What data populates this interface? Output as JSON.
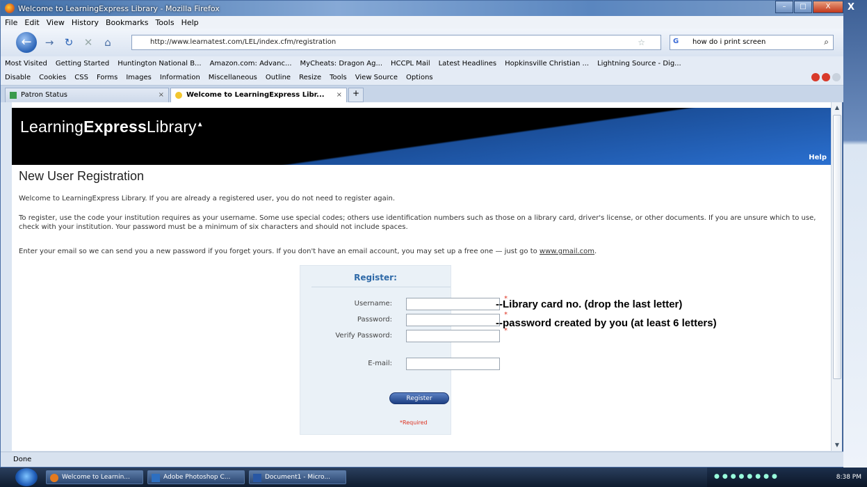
{
  "window": {
    "title": "Welcome to LearningExpress Library - Mozilla Firefox",
    "controls": {
      "minimize": "–",
      "maximize": "□",
      "close": "X"
    }
  },
  "menu": [
    "File",
    "Edit",
    "View",
    "History",
    "Bookmarks",
    "Tools",
    "Help"
  ],
  "nav": {
    "url": "http://www.learnatest.com/LEL/index.cfm/registration",
    "search_value": "how do i print screen"
  },
  "bookmarks": [
    "Most Visited",
    "Getting Started",
    "Huntington National B...",
    "Amazon.com: Advanc...",
    "MyCheats: Dragon Ag...",
    "HCCPL Mail",
    "Latest Headlines",
    "Hopkinsville Christian ...",
    "Lightning Source - Dig..."
  ],
  "devtoolbar": [
    "Disable",
    "Cookies",
    "CSS",
    "Forms",
    "Images",
    "Information",
    "Miscellaneous",
    "Outline",
    "Resize",
    "Tools",
    "View Source",
    "Options"
  ],
  "tabs": [
    {
      "label": "Patron Status"
    },
    {
      "label": "Welcome to LearningExpress Libr..."
    }
  ],
  "banner": {
    "logo_light": "Learning",
    "logo_bold": "Express",
    "logo_light2": "Library",
    "help": "Help"
  },
  "page": {
    "title": "New User Registration",
    "p1": "Welcome to LearningExpress Library. If you are already a registered user, you do not need to register again.",
    "p2": "To register, use the code your institution requires as your username. Some use special codes; others use identification numbers such as those on a library card, driver's license, or other documents. If you are unsure which to use, check with your institution. Your password must be a minimum of six characters and should not include spaces.",
    "p3_before": "Enter your email so we can send you a new password if you forget yours. If you don't have an email account, you may set up a free one — just go to ",
    "p3_link": "www.gmail.com",
    "p3_after": "."
  },
  "form": {
    "title": "Register:",
    "username_label": "Username:",
    "password_label": "Password:",
    "verify_label": "Verify Password:",
    "email_label": "E-mail:",
    "button": "Register",
    "required_mark": "*",
    "required_note": "*Required"
  },
  "annotations": {
    "username_note": "--Library card no. (drop the last letter)",
    "password_note": "--password created by you (at least 6 letters)"
  },
  "status": "Done",
  "taskbar": {
    "items": [
      "Welcome to Learnin...",
      "Adobe Photoshop C...",
      "Document1 - Micro..."
    ],
    "clock": "8:38 PM"
  }
}
